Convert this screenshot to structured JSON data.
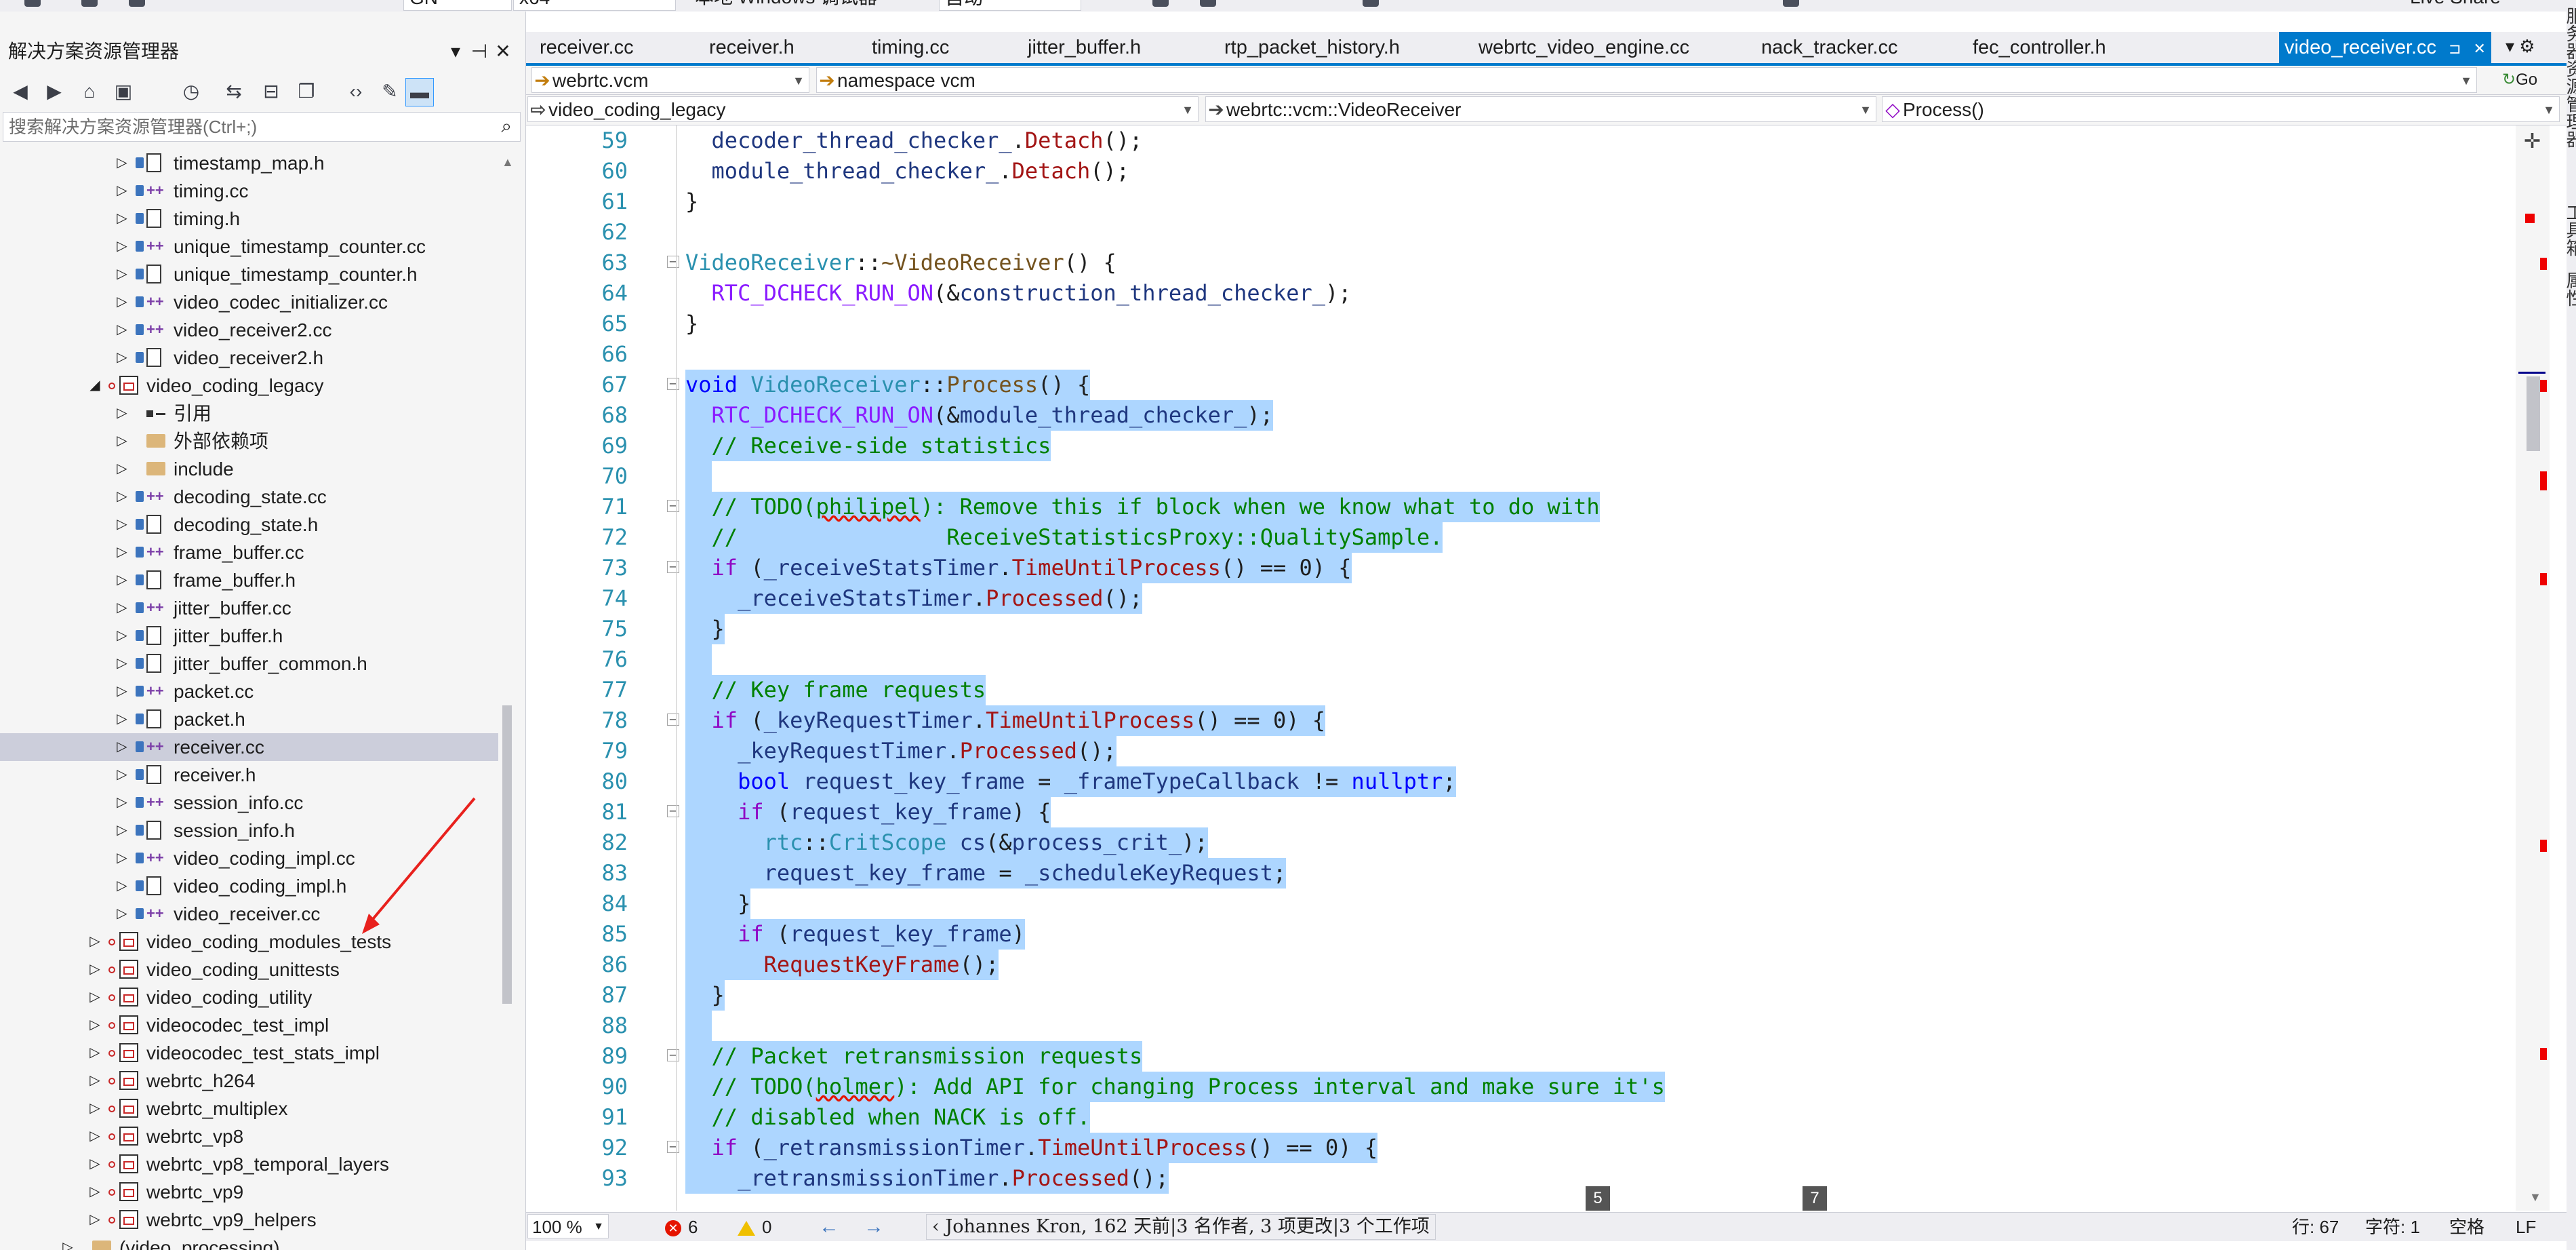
{
  "top_toolbar": {
    "config_combo": "GN",
    "platform_combo": "x64",
    "debugger_label": "本地 Windows 调试器",
    "auto_combo": "自动",
    "live_share": "Live Share"
  },
  "solution_explorer": {
    "title": "解决方案资源管理器",
    "search_placeholder": "搜索解决方案资源管理器(Ctrl+;)",
    "pin_glyph": "⊣",
    "close_glyph": "✕",
    "dropdown_glyph": "▾",
    "tree": [
      {
        "label": "timestamp_map.h",
        "level": 2,
        "type": "h"
      },
      {
        "label": "timing.cc",
        "level": 2,
        "type": "cc"
      },
      {
        "label": "timing.h",
        "level": 2,
        "type": "h"
      },
      {
        "label": "unique_timestamp_counter.cc",
        "level": 2,
        "type": "cc"
      },
      {
        "label": "unique_timestamp_counter.h",
        "level": 2,
        "type": "h"
      },
      {
        "label": "video_codec_initializer.cc",
        "level": 2,
        "type": "cc"
      },
      {
        "label": "video_receiver2.cc",
        "level": 2,
        "type": "cc"
      },
      {
        "label": "video_receiver2.h",
        "level": 2,
        "type": "h"
      },
      {
        "label": "video_coding_legacy",
        "level": 1,
        "type": "project",
        "expanded": true
      },
      {
        "label": "引用",
        "level": 2,
        "type": "ref"
      },
      {
        "label": "外部依赖项",
        "level": 2,
        "type": "folder"
      },
      {
        "label": "include",
        "level": 2,
        "type": "folder"
      },
      {
        "label": "decoding_state.cc",
        "level": 2,
        "type": "cc"
      },
      {
        "label": "decoding_state.h",
        "level": 2,
        "type": "h"
      },
      {
        "label": "frame_buffer.cc",
        "level": 2,
        "type": "cc"
      },
      {
        "label": "frame_buffer.h",
        "level": 2,
        "type": "h"
      },
      {
        "label": "jitter_buffer.cc",
        "level": 2,
        "type": "cc"
      },
      {
        "label": "jitter_buffer.h",
        "level": 2,
        "type": "h"
      },
      {
        "label": "jitter_buffer_common.h",
        "level": 2,
        "type": "h"
      },
      {
        "label": "packet.cc",
        "level": 2,
        "type": "cc"
      },
      {
        "label": "packet.h",
        "level": 2,
        "type": "h"
      },
      {
        "label": "receiver.cc",
        "level": 2,
        "type": "cc",
        "selected": true
      },
      {
        "label": "receiver.h",
        "level": 2,
        "type": "h"
      },
      {
        "label": "session_info.cc",
        "level": 2,
        "type": "cc"
      },
      {
        "label": "session_info.h",
        "level": 2,
        "type": "h"
      },
      {
        "label": "video_coding_impl.cc",
        "level": 2,
        "type": "cc"
      },
      {
        "label": "video_coding_impl.h",
        "level": 2,
        "type": "h"
      },
      {
        "label": "video_receiver.cc",
        "level": 2,
        "type": "cc"
      },
      {
        "label": "video_coding_modules_tests",
        "level": 1,
        "type": "project"
      },
      {
        "label": "video_coding_unittests",
        "level": 1,
        "type": "project"
      },
      {
        "label": "video_coding_utility",
        "level": 1,
        "type": "project"
      },
      {
        "label": "videocodec_test_impl",
        "level": 1,
        "type": "project"
      },
      {
        "label": "videocodec_test_stats_impl",
        "level": 1,
        "type": "project"
      },
      {
        "label": "webrtc_h264",
        "level": 1,
        "type": "project"
      },
      {
        "label": "webrtc_multiplex",
        "level": 1,
        "type": "project"
      },
      {
        "label": "webrtc_vp8",
        "level": 1,
        "type": "project"
      },
      {
        "label": "webrtc_vp8_temporal_layers",
        "level": 1,
        "type": "project"
      },
      {
        "label": "webrtc_vp9",
        "level": 1,
        "type": "project"
      },
      {
        "label": "webrtc_vp9_helpers",
        "level": 1,
        "type": "project"
      },
      {
        "label": "(video_processing)",
        "level": 0,
        "type": "folder"
      }
    ]
  },
  "tabs": [
    {
      "label": "receiver.cc"
    },
    {
      "label": "receiver.h"
    },
    {
      "label": "timing.cc"
    },
    {
      "label": "jitter_buffer.h"
    },
    {
      "label": "rtp_packet_history.h"
    },
    {
      "label": "webrtc_video_engine.cc"
    },
    {
      "label": "nack_tracker.cc"
    },
    {
      "label": "fec_controller.h"
    },
    {
      "label": "video_receiver.cc",
      "active": true
    }
  ],
  "tab_controls": {
    "pin": "⊐",
    "close": "✕",
    "overflow": "▾ ⚙"
  },
  "nav": {
    "project_combo": "webrtc.vcm",
    "namespace_combo": "namespace vcm",
    "go_label": "Go",
    "file_scope": "video_coding_legacy",
    "class_scope": "webrtc::vcm::VideoReceiver",
    "member_scope": "Process()"
  },
  "code_lines": [
    {
      "n": "59",
      "sel": false,
      "html": "  <span class='c-var'>decoder_thread_checker_</span>.<span class='c-mem'>Detach</span>();"
    },
    {
      "n": "60",
      "sel": false,
      "html": "  <span class='c-var'>module_thread_checker_</span>.<span class='c-mem'>Detach</span>();"
    },
    {
      "n": "61",
      "sel": false,
      "html": "}"
    },
    {
      "n": "62",
      "sel": false,
      "html": ""
    },
    {
      "n": "63",
      "sel": false,
      "fold": true,
      "html": "<span class='c-cls'>VideoReceiver</span>::<span class='c-fn'>~VideoReceiver</span>() {"
    },
    {
      "n": "64",
      "sel": false,
      "html": "  <span class='c-mac'>RTC_DCHECK_RUN_ON</span>(&amp;<span class='c-var'>construction_thread_checker_</span>);"
    },
    {
      "n": "65",
      "sel": false,
      "html": "}"
    },
    {
      "n": "66",
      "sel": false,
      "html": ""
    },
    {
      "n": "67",
      "sel": true,
      "fold": true,
      "html": "<span class='c-kw'>void</span> <span class='c-cls'>VideoReceiver</span>::<span class='c-fn'>Process</span>() {"
    },
    {
      "n": "68",
      "sel": true,
      "html": "  <span class='c-mac'>RTC_DCHECK_RUN_ON</span>(&amp;<span class='c-var'>module_thread_checker_</span>);"
    },
    {
      "n": "69",
      "sel": true,
      "html": "  <span class='c-cm'>// Receive-side statistics</span>"
    },
    {
      "n": "70",
      "sel": true,
      "html": ""
    },
    {
      "n": "71",
      "sel": true,
      "fold": true,
      "html": "  <span class='c-cm'>// TODO(<span class='c-sq'>philipel</span>): Remove this if block when we know what to do with</span>"
    },
    {
      "n": "72",
      "sel": true,
      "html": "  <span class='c-cm'>//                ReceiveStatisticsProxy::QualitySample.</span>"
    },
    {
      "n": "73",
      "sel": true,
      "fold": true,
      "html": "  <span class='c-kw2'>if</span> (<span class='c-var'>_receiveStatsTimer</span>.<span class='c-mem'>TimeUntilProcess</span>() == 0) {"
    },
    {
      "n": "74",
      "sel": true,
      "html": "    <span class='c-var'>_receiveStatsTimer</span>.<span class='c-mem'>Processed</span>();"
    },
    {
      "n": "75",
      "sel": true,
      "html": "  }"
    },
    {
      "n": "76",
      "sel": true,
      "html": ""
    },
    {
      "n": "77",
      "sel": true,
      "html": "  <span class='c-cm'>// Key frame requests</span>"
    },
    {
      "n": "78",
      "sel": true,
      "fold": true,
      "html": "  <span class='c-kw2'>if</span> (<span class='c-var'>_keyRequestTimer</span>.<span class='c-mem'>TimeUntilProcess</span>() == 0) {"
    },
    {
      "n": "79",
      "sel": true,
      "html": "    <span class='c-var'>_keyRequestTimer</span>.<span class='c-mem'>Processed</span>();"
    },
    {
      "n": "80",
      "sel": true,
      "html": "    <span class='c-kw'>bool</span> <span class='c-var'>request_key_frame</span> = <span class='c-var'>_frameTypeCallback</span> != <span class='c-kw'>nullptr</span>;"
    },
    {
      "n": "81",
      "sel": true,
      "fold": true,
      "html": "    <span class='c-kw2'>if</span> (<span class='c-var'>request_key_frame</span>) {"
    },
    {
      "n": "82",
      "sel": true,
      "html": "      <span class='c-cls'>rtc</span>::<span class='c-cls'>CritScope</span> <span class='c-var'>cs</span>(&amp;<span class='c-var'>process_crit_</span>);"
    },
    {
      "n": "83",
      "sel": true,
      "html": "      <span class='c-var'>request_key_frame</span> = <span class='c-var'>_scheduleKeyRequest</span>;"
    },
    {
      "n": "84",
      "sel": true,
      "html": "    }"
    },
    {
      "n": "85",
      "sel": true,
      "html": "    <span class='c-kw2'>if</span> (<span class='c-var'>request_key_frame</span>)"
    },
    {
      "n": "86",
      "sel": true,
      "html": "      <span class='c-mem'>RequestKeyFrame</span>();"
    },
    {
      "n": "87",
      "sel": true,
      "html": "  }"
    },
    {
      "n": "88",
      "sel": true,
      "html": ""
    },
    {
      "n": "89",
      "sel": true,
      "fold": true,
      "html": "  <span class='c-cm'>// Packet retransmission requests</span>"
    },
    {
      "n": "90",
      "sel": true,
      "html": "  <span class='c-cm'>// TODO(<span class='c-sq'>holmer</span>): Add API for changing Process interval and make sure it's</span>"
    },
    {
      "n": "91",
      "sel": true,
      "html": "  <span class='c-cm'>// disabled when NACK is off.</span>"
    },
    {
      "n": "92",
      "sel": true,
      "fold": true,
      "html": "  <span class='c-kw2'>if</span> (<span class='c-var'>_retransmissionTimer</span>.<span class='c-mem'>TimeUntilProcess</span>() == 0) {"
    },
    {
      "n": "93",
      "sel": true,
      "html": "    <span class='c-var'>_retransmissionTimer</span>.<span class='c-mem'>Processed</span>();"
    }
  ],
  "ime_candidates": [
    "5",
    "7"
  ],
  "status": {
    "zoom": "100 %",
    "errors": "6",
    "warnings": "0",
    "nav_back": "←",
    "nav_forward": "→",
    "blame": "Johannes Kron, 162 天前|3 名作者, 3 项更改|3 个工作项",
    "line": "行: 67",
    "col": "字符: 1",
    "spaces": "空格",
    "eol": "LF"
  },
  "right_panel": {
    "labels": [
      "服务器资源管理器",
      "工具箱",
      "属性"
    ]
  },
  "colors": {
    "accent": "#007acc",
    "selection": "#add6ff",
    "tree_selected": "#cccedb"
  }
}
